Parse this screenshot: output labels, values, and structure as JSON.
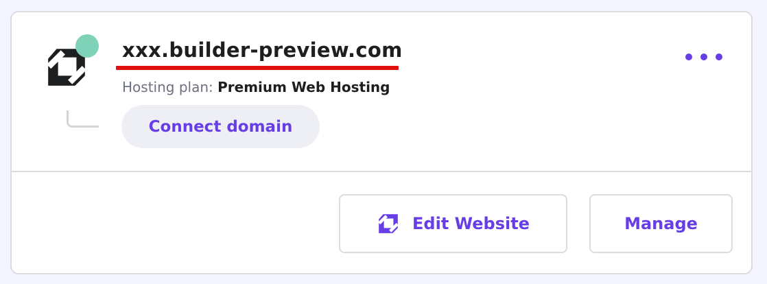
{
  "website": {
    "domain": "xxx.builder-preview.com",
    "hosting_plan_label": "Hosting plan:",
    "hosting_plan_value": "Premium Web Hosting",
    "status": "online"
  },
  "actions": {
    "connect_domain_label": "Connect domain",
    "edit_website_label": "Edit Website",
    "manage_label": "Manage"
  },
  "icons": {
    "logo": "website-builder-logo-icon",
    "status": "status-dot-icon",
    "more": "more-options-icon",
    "edit": "website-builder-logo-icon"
  },
  "colors": {
    "accent": "#673de6",
    "logo": "#1d1e20",
    "status_dot": "#7fd2b8",
    "annotation_underline": "#e0100f",
    "page_background": "#f4f5ff",
    "border": "#dadce0"
  }
}
